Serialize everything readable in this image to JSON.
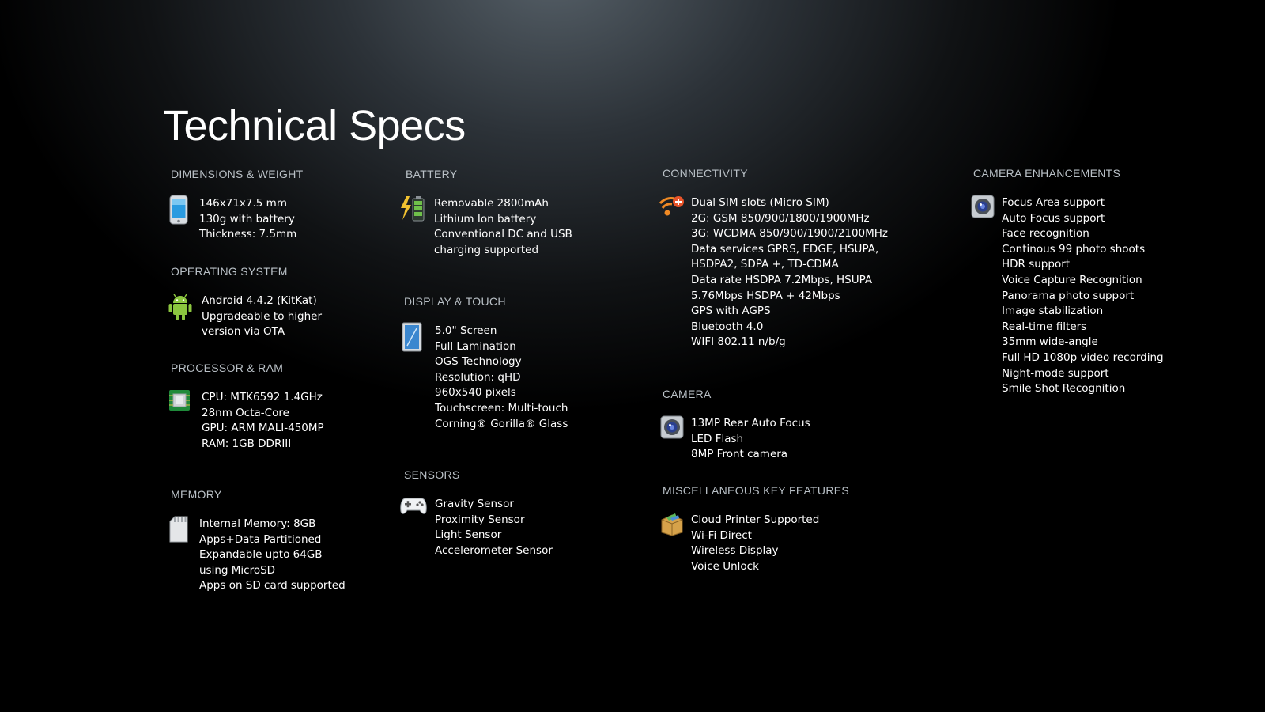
{
  "title": "Technical Specs",
  "sections": {
    "dimensions": {
      "heading": "DIMENSIONS & WEIGHT",
      "icon": "smartphone-icon",
      "lines": [
        "146x71x7.5 mm",
        "130g with battery",
        "Thickness: 7.5mm"
      ]
    },
    "os": {
      "heading": "OPERATING SYSTEM",
      "icon": "android-icon",
      "lines": [
        "Android 4.4.2 (KitKat)",
        "Upgradeable to higher",
        "version via OTA"
      ]
    },
    "processor": {
      "heading": "PROCESSOR & RAM",
      "icon": "chip-icon",
      "lines": [
        "CPU: MTK6592 1.4GHz",
        "28nm Octa-Core",
        "GPU: ARM MALI-450MP",
        "RAM: 1GB DDRIII"
      ]
    },
    "memory": {
      "heading": "MEMORY",
      "icon": "sd-card-icon",
      "lines": [
        "Internal Memory: 8GB",
        "Apps+Data Partitioned",
        "Expandable upto 64GB",
        "using MicroSD",
        "Apps on SD card supported"
      ]
    },
    "battery": {
      "heading": "BATTERY",
      "icon": "battery-charging-icon",
      "lines": [
        "Removable 2800mAh",
        "Lithium Ion battery",
        "Conventional DC and USB",
        "charging supported"
      ]
    },
    "display": {
      "heading": "DISPLAY & TOUCH",
      "icon": "tablet-screen-icon",
      "lines": [
        "5.0\" Screen",
        "Full Lamination",
        "OGS Technology",
        "Resolution: qHD",
        "960x540 pixels",
        "Touchscreen: Multi-touch",
        "Corning® Gorilla® Glass"
      ]
    },
    "sensors": {
      "heading": "SENSORS",
      "icon": "gamepad-icon",
      "lines": [
        "Gravity Sensor",
        "Proximity Sensor",
        "Light Sensor",
        "Accelerometer Sensor"
      ]
    },
    "connectivity": {
      "heading": "CONNECTIVITY",
      "icon": "wireless-signal-icon",
      "lines": [
        "Dual SIM slots (Micro SIM)",
        "2G: GSM 850/900/1800/1900MHz",
        "3G: WCDMA 850/900/1900/2100MHz",
        "Data services GPRS, EDGE, HSUPA,",
        "HSDPA2, SDPA +, TD-CDMA",
        "Data rate HSDPA 7.2Mbps, HSUPA",
        "5.76Mbps HSDPA + 42Mbps",
        "GPS with AGPS",
        "Bluetooth 4.0",
        "WIFI 802.11 n/b/g"
      ]
    },
    "camera": {
      "heading": "CAMERA",
      "icon": "camera-icon",
      "lines": [
        "13MP Rear Auto Focus",
        "LED Flash",
        "8MP Front camera"
      ]
    },
    "misc": {
      "heading": "MISCELLANEOUS KEY FEATURES",
      "icon": "package-box-icon",
      "lines": [
        "Cloud Printer Supported",
        "Wi-Fi Direct",
        "Wireless Display",
        "Voice Unlock"
      ]
    },
    "camera_enh": {
      "heading": "CAMERA ENHANCEMENTS",
      "icon": "camera-icon",
      "lines": [
        "Focus Area support",
        "Auto Focus support",
        "Face recognition",
        "Continous 99 photo shoots",
        "HDR support",
        "Voice Capture Recognition",
        "Panorama photo support",
        "Image stabilization",
        "Real-time filters",
        "35mm wide-angle",
        "Full HD 1080p video recording",
        "Night-mode support",
        "Smile Shot Recognition"
      ]
    }
  }
}
